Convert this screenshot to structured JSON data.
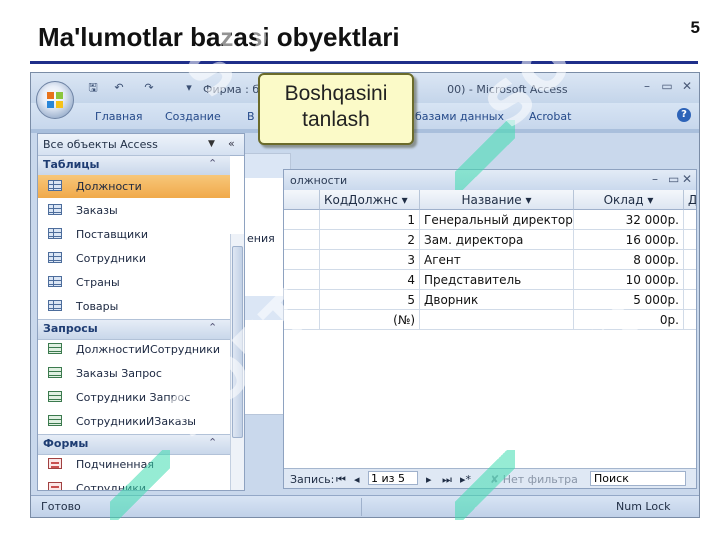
{
  "slide": {
    "title": "Ma'lumotlar bazasi obyektlari",
    "number": "5"
  },
  "window": {
    "title": "Фирма : б",
    "title_suffix": "00) - Microsoft Access",
    "ribbon_tabs": [
      "Главная",
      "Создание",
      "В",
      "базами данных",
      "Acrobat"
    ]
  },
  "callout": {
    "text": "Boshqasini tanlash"
  },
  "nav": {
    "selector": "Все объекты Access",
    "groups": [
      {
        "label": "Таблицы",
        "items": [
          "Должности",
          "Заказы",
          "Поставщики",
          "Сотрудники",
          "Страны",
          "Товары"
        ],
        "selected": "Должности",
        "icon": "table-icon"
      },
      {
        "label": "Запросы",
        "items": [
          "ДолжностиИСотрудники",
          "Заказы Запрос",
          "Сотрудники Запрос",
          "СотрудникиИЗаказы"
        ],
        "icon": "query-icon"
      },
      {
        "label": "Формы",
        "items": [
          "Подчиненная",
          "Сотрудники"
        ],
        "icon": "form-icon"
      }
    ]
  },
  "behind_panel": {
    "partial_text": "ения"
  },
  "datasheet": {
    "title": "олжности",
    "columns": [
      "КодДолжнс",
      "Название",
      "Оклад",
      "Д"
    ],
    "rows": [
      [
        "1",
        "Генеральный директор",
        "32 000р."
      ],
      [
        "2",
        "Зам. директора",
        "16 000р."
      ],
      [
        "3",
        "Агент",
        "8 000р."
      ],
      [
        "4",
        "Представитель",
        "10 000р."
      ],
      [
        "5",
        "Дворник",
        "5 000р."
      ],
      [
        "(№)",
        "",
        "0р."
      ]
    ],
    "record_label": "Запись:",
    "record_value": "1 из 5",
    "filter_label": "Нет фильтра",
    "search_label": "Поиск"
  },
  "status": {
    "left": "Готово",
    "right": "Num Lock"
  },
  "watermark": "SOFT"
}
